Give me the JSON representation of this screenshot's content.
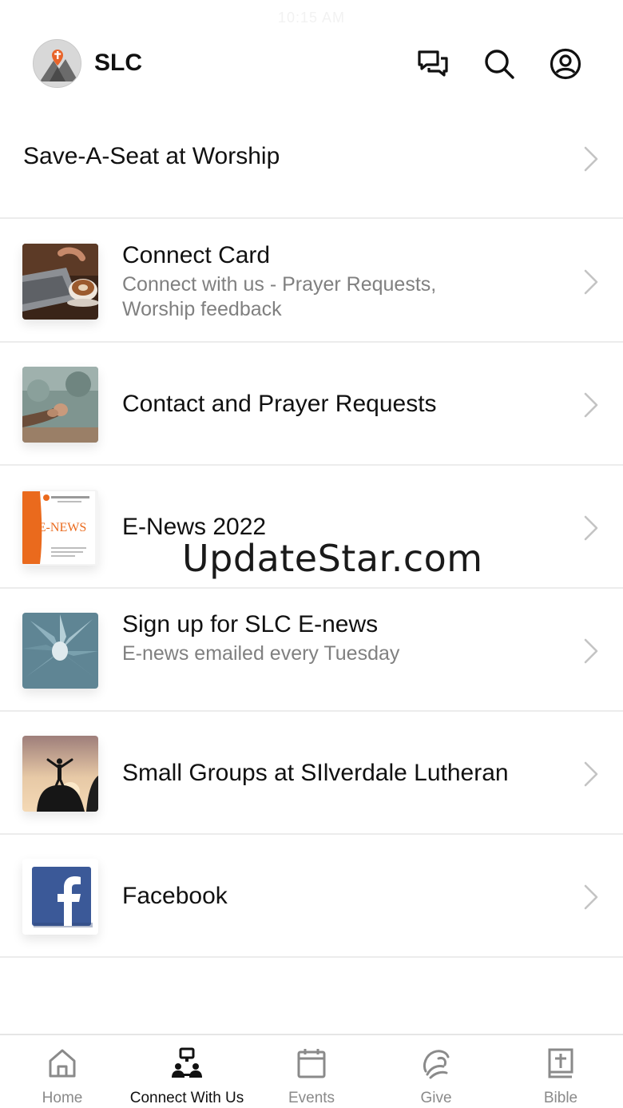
{
  "status_bar": {
    "time": "10:15 AM"
  },
  "header": {
    "app_title": "SLC",
    "icons": [
      "chat-icon",
      "search-icon",
      "profile-icon"
    ]
  },
  "top_item": {
    "label": "Save-A-Seat at Worship"
  },
  "list": [
    {
      "title": "Connect Card",
      "subtitle": "Connect with us - Prayer Requests, Worship feedback",
      "thumb": "coffee-laptop"
    },
    {
      "title": "Contact and Prayer Requests",
      "subtitle": "",
      "thumb": "praying-hands"
    },
    {
      "title": "E-News 2022",
      "subtitle": "",
      "thumb": "enews-flyer",
      "thumb_text": "E-NEWS"
    },
    {
      "title": "Sign up for SLC E-news",
      "subtitle": "E-news emailed every Tuesday",
      "thumb": "succulent"
    },
    {
      "title": "Small Groups at SIlverdale Lutheran",
      "subtitle": "",
      "thumb": "sunset-silhouette"
    },
    {
      "title": "Facebook",
      "subtitle": "",
      "thumb": "facebook-logo"
    }
  ],
  "watermark": "UpdateStar.com",
  "tabs": [
    {
      "label": "Home",
      "icon": "home-icon",
      "active": false
    },
    {
      "label": "Connect With Us",
      "icon": "connect-icon",
      "active": true
    },
    {
      "label": "Events",
      "icon": "calendar-icon",
      "active": false
    },
    {
      "label": "Give",
      "icon": "give-icon",
      "active": false
    },
    {
      "label": "Bible",
      "icon": "bible-icon",
      "active": false
    }
  ],
  "colors": {
    "accent": "#111111",
    "inactive": "#8a8a8a",
    "subtitle": "#808080",
    "divider": "#ececec",
    "facebook": "#3b5998"
  }
}
